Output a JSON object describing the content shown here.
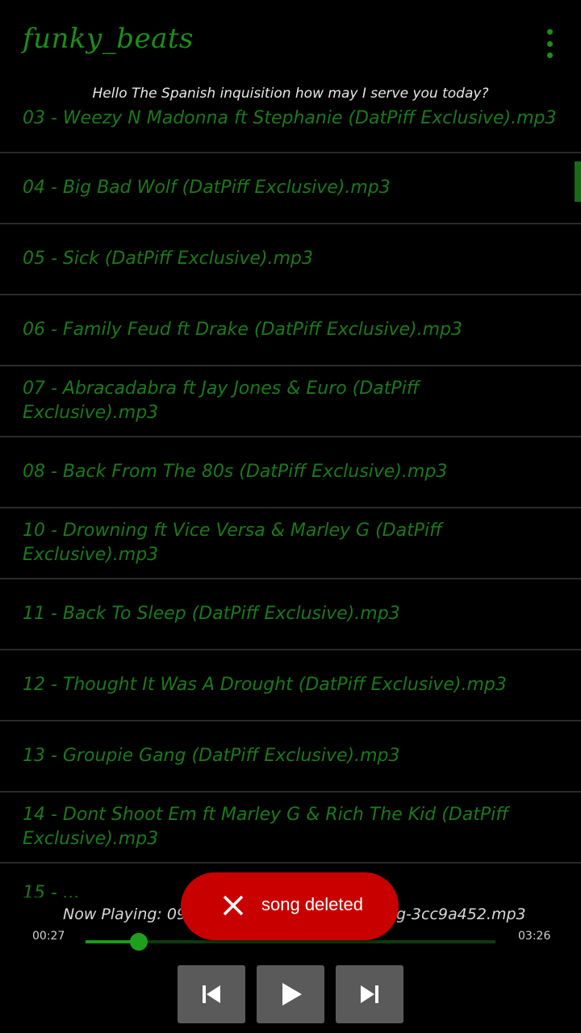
{
  "header": {
    "title": "funky_beats",
    "menu_icon": "overflow-menu-icon"
  },
  "greeting": "Hello The Spanish inquisition how may I serve you today?",
  "songs": [
    "03 - Weezy N Madonna ft Stephanie (DatPiff Exclusive).mp3",
    "04 - Big Bad Wolf (DatPiff Exclusive).mp3",
    "05 - Sick (DatPiff Exclusive).mp3",
    "06 - Family Feud ft Drake (DatPiff Exclusive).mp3",
    "07 - Abracadabra ft Jay Jones & Euro (DatPiff Exclusive).mp3",
    "08 - Back From The 80s (DatPiff Exclusive).mp3",
    "10 - Drowning ft Vice Versa & Marley G (DatPiff Exclusive).mp3",
    "11 - Back To Sleep (DatPiff Exclusive).mp3",
    "12 - Thought It Was A Drought (DatPiff Exclusive).mp3",
    "13 - Groupie Gang (DatPiff Exclusive).mp3",
    "14 - Dont Shoot Em ft Marley G & Rich The Kid (DatPiff Exclusive).mp3",
    "15 - ..."
  ],
  "player": {
    "now_playing": "Now Playing: 09-dj_lilious-4_new_you_calling-3cc9a452.mp3",
    "current_time": "00:27",
    "total_time": "03:26",
    "progress": 0.13,
    "buttons": {
      "prev_icon": "skip-previous-icon",
      "play_icon": "play-icon",
      "next_icon": "skip-next-icon"
    }
  },
  "toast": {
    "message": "song deleted",
    "icon": "close-icon"
  },
  "colors": {
    "accent": "#1a7f1a",
    "background": "#000000",
    "toast": "#c90000"
  }
}
